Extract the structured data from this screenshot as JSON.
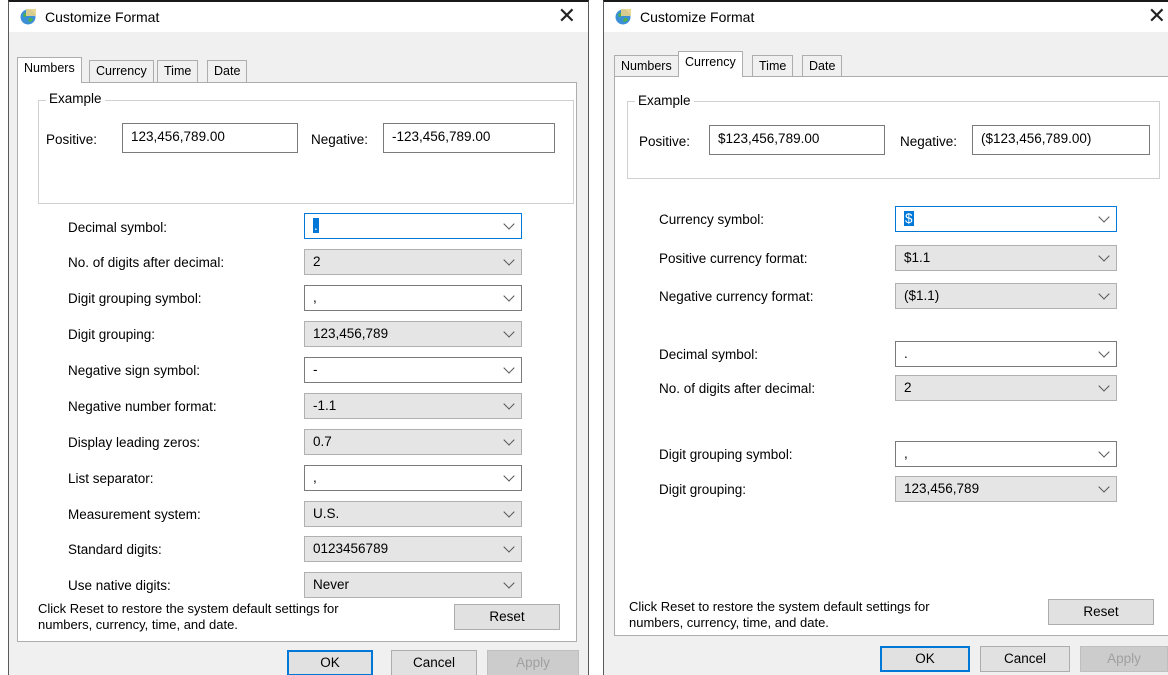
{
  "dialog_left": {
    "title": "Customize Format",
    "close_glyph": "✕",
    "tabs": [
      {
        "label": "Numbers",
        "active": true
      },
      {
        "label": "Currency"
      },
      {
        "label": "Time"
      },
      {
        "label": "Date"
      }
    ],
    "example": {
      "legend": "Example",
      "positive_label": "Positive:",
      "positive_value": "123,456,789.00",
      "negative_label": "Negative:",
      "negative_value": "-123,456,789.00"
    },
    "fields": [
      {
        "label": "Decimal symbol:",
        "value": ".",
        "editable": true,
        "focused": true
      },
      {
        "label": "No. of digits after decimal:",
        "value": "2"
      },
      {
        "label": "Digit grouping symbol:",
        "value": ",",
        "editable": true
      },
      {
        "label": "Digit grouping:",
        "value": "123,456,789"
      },
      {
        "label": "Negative sign symbol:",
        "value": "-",
        "editable": true
      },
      {
        "label": "Negative number format:",
        "value": "-1.1"
      },
      {
        "label": "Display leading zeros:",
        "value": "0.7"
      },
      {
        "label": "List separator:",
        "value": ",",
        "editable": true
      },
      {
        "label": "Measurement system:",
        "value": "U.S."
      },
      {
        "label": "Standard digits:",
        "value": "0123456789"
      },
      {
        "label": "Use native digits:",
        "value": "Never"
      }
    ],
    "info_line1": "Click Reset to restore the system default settings for",
    "info_line2": "numbers, currency, time, and date.",
    "reset_label": "Reset",
    "ok_label": "OK",
    "cancel_label": "Cancel",
    "apply_label": "Apply"
  },
  "dialog_right": {
    "title": "Customize Format",
    "close_glyph": "✕",
    "tabs": [
      {
        "label": "Numbers"
      },
      {
        "label": "Currency",
        "active": true
      },
      {
        "label": "Time"
      },
      {
        "label": "Date"
      }
    ],
    "example": {
      "legend": "Example",
      "positive_label": "Positive:",
      "positive_value": "$123,456,789.00",
      "negative_label": "Negative:",
      "negative_value": "($123,456,789.00)"
    },
    "fields": [
      {
        "label": "Currency symbol:",
        "value": "$",
        "editable": true,
        "focused": true
      },
      {
        "label": "Positive currency format:",
        "value": "$1.1"
      },
      {
        "label": "Negative currency format:",
        "value": "($1.1)"
      },
      {
        "label": "Decimal symbol:",
        "value": ".",
        "editable": true
      },
      {
        "label": "No. of digits after decimal:",
        "value": "2"
      },
      {
        "label": "Digit grouping symbol:",
        "value": ",",
        "editable": true
      },
      {
        "label": "Digit grouping:",
        "value": "123,456,789"
      }
    ],
    "info_line1": "Click Reset to restore the system default settings for",
    "info_line2": "numbers, currency, time, and date.",
    "reset_label": "Reset",
    "ok_label": "OK",
    "cancel_label": "Cancel",
    "apply_label": "Apply"
  },
  "colors": {
    "accent": "#0078d7",
    "dialog_bg": "#f0f0f0",
    "readonly_field": "#e5e5e5"
  }
}
